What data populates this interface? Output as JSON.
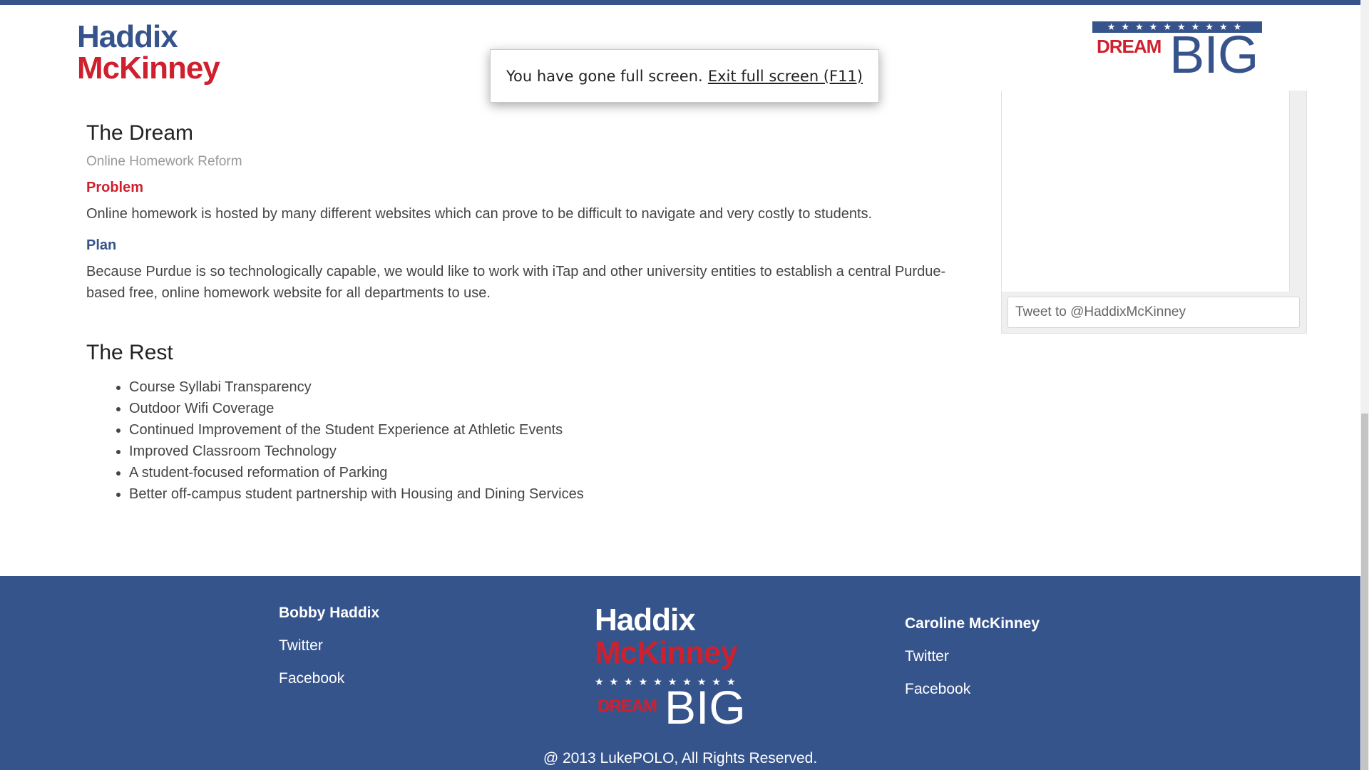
{
  "header": {
    "logo_line1": "Haddix",
    "logo_line2": "McKinney",
    "badge_stars": "★★★★★★★★★★",
    "badge_dream": "DREAM",
    "badge_big": "BIG"
  },
  "fullscreen_notice": {
    "message": "You have gone full screen.",
    "exit_label": "Exit full screen (F11)"
  },
  "dream": {
    "title": "The Dream",
    "subtitle": "Online Homework Reform",
    "problem_heading": "Problem",
    "problem_text": "Online homework is hosted by many different websites which can prove to be difficult to navigate and very costly to students.",
    "plan_heading": "Plan",
    "plan_text": "Because Purdue is so technologically capable, we would like to work with iTap and other university entities to establish a central Purdue-based free, online homework website for all departments to use."
  },
  "rest": {
    "title": "The Rest",
    "items": [
      "Course Syllabi Transparency",
      "Outdoor Wifi Coverage",
      "Continued Improvement of the Student Experience at Athletic Events",
      "Improved Classroom Technology",
      "A student-focused reformation of Parking",
      "Better off-campus student partnership with Housing and Dining Services"
    ]
  },
  "twitter_widget": {
    "tweet_placeholder": "Tweet to @HaddixMcKinney"
  },
  "footer": {
    "left": {
      "name": "Bobby Haddix",
      "twitter": "Twitter",
      "facebook": "Facebook"
    },
    "right": {
      "name": "Caroline McKinney",
      "twitter": "Twitter",
      "facebook": "Facebook"
    },
    "logo_line1": "Haddix",
    "logo_line2": "McKinney",
    "logo_stars": "★★★★★★★★★★",
    "logo_dream": "DREAM",
    "logo_big": "BIG",
    "copyright": "@ 2013 LukePOLO, All Rights Reserved."
  },
  "colors": {
    "brand_blue": "#36538b",
    "brand_red": "#cf202e"
  }
}
